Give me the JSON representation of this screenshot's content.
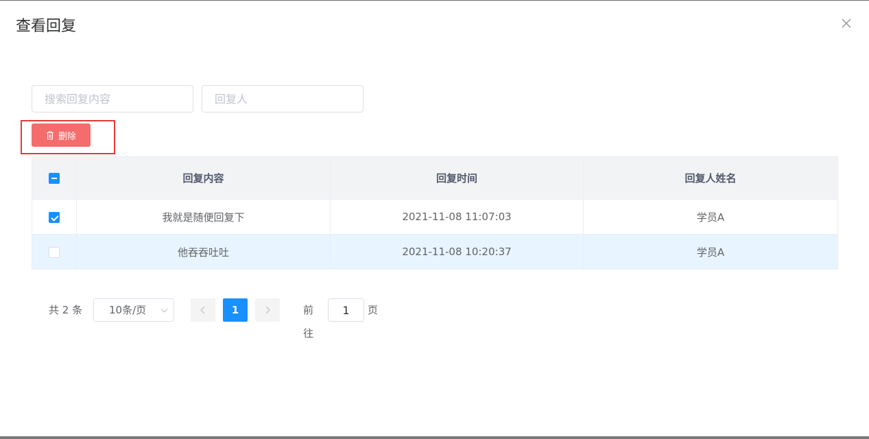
{
  "dialog": {
    "title": "查看回复",
    "close_icon": "close-icon"
  },
  "filters": {
    "content_placeholder": "搜索回复内容",
    "content_value": "",
    "replier_placeholder": "回复人",
    "replier_value": ""
  },
  "toolbar": {
    "delete_label": "删除",
    "delete_icon": "trash-icon",
    "delete_color": "#f56c6c",
    "highlight_color": "#e53935"
  },
  "table": {
    "select_all_state": "indeterminate",
    "columns": [
      "回复内容",
      "回复时间",
      "回复人姓名"
    ],
    "rows": [
      {
        "checked": true,
        "content": "我就是随便回复下",
        "time": "2021-11-08 11:07:03",
        "name": "学员A"
      },
      {
        "checked": false,
        "content": "他吞吞吐吐",
        "time": "2021-11-08 10:20:37",
        "name": "学员A"
      }
    ]
  },
  "pagination": {
    "total_text": "共 2 条",
    "page_size": "10条/页",
    "current_page": "1",
    "goto_label": "前往",
    "goto_value": "1",
    "page_suffix": "页",
    "accent_color": "#1890ff"
  }
}
